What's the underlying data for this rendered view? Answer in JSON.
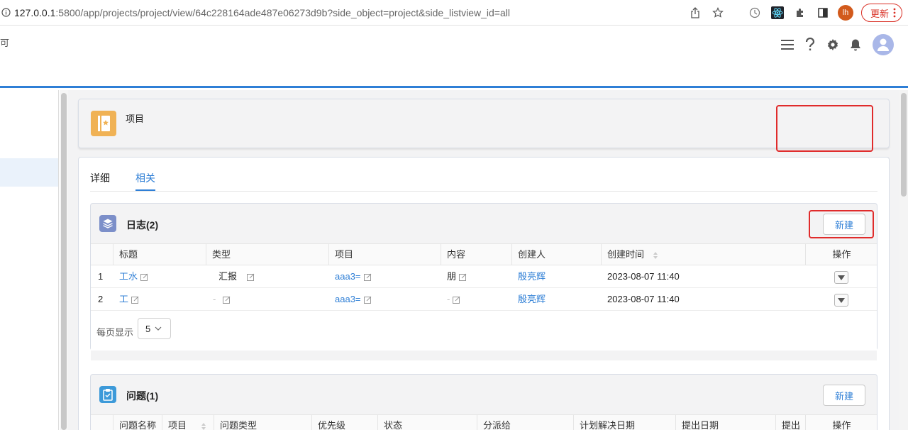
{
  "browser": {
    "url_host": "127.0.0.1",
    "url_rest": ":5800/app/projects/project/view/64c228164ade487e06273d9b?side_object=project&side_listview_id=all",
    "profile_initials": "lh",
    "update_label": "更新"
  },
  "header": {
    "fragment": "可"
  },
  "record": {
    "title": "项目",
    "icon": "project-icon",
    "accent_color": "#f0b255"
  },
  "tabs": [
    {
      "label": "详细"
    },
    {
      "label": "相关"
    }
  ],
  "logs": {
    "title": "日志(2)",
    "new_label": "新建",
    "columns": [
      "标题",
      "类型",
      "项目",
      "内容",
      "创建人",
      "创建时间",
      "操作"
    ],
    "rows": [
      {
        "index": "1",
        "title": "工水",
        "type": "汇报",
        "project": "aaa3=",
        "content": "朋",
        "creator": "殷亮辉",
        "created": "2023-08-07 11:40"
      },
      {
        "index": "2",
        "title": "工",
        "type": "-",
        "project": "aaa3=",
        "content": "-",
        "creator": "殷亮辉",
        "created": "2023-08-07 11:40"
      }
    ],
    "page_size_label": "每页显示",
    "page_size": "5"
  },
  "issues": {
    "title": "问题(1)",
    "new_label": "新建",
    "columns": [
      "问题名称",
      "项目",
      "问题类型",
      "优先级",
      "状态",
      "分派给",
      "计划解决日期",
      "提出日期",
      "提出",
      "操作"
    ]
  },
  "colors": {
    "brand_blue": "#2f7fd6",
    "highlight_red": "#e02b2b"
  }
}
